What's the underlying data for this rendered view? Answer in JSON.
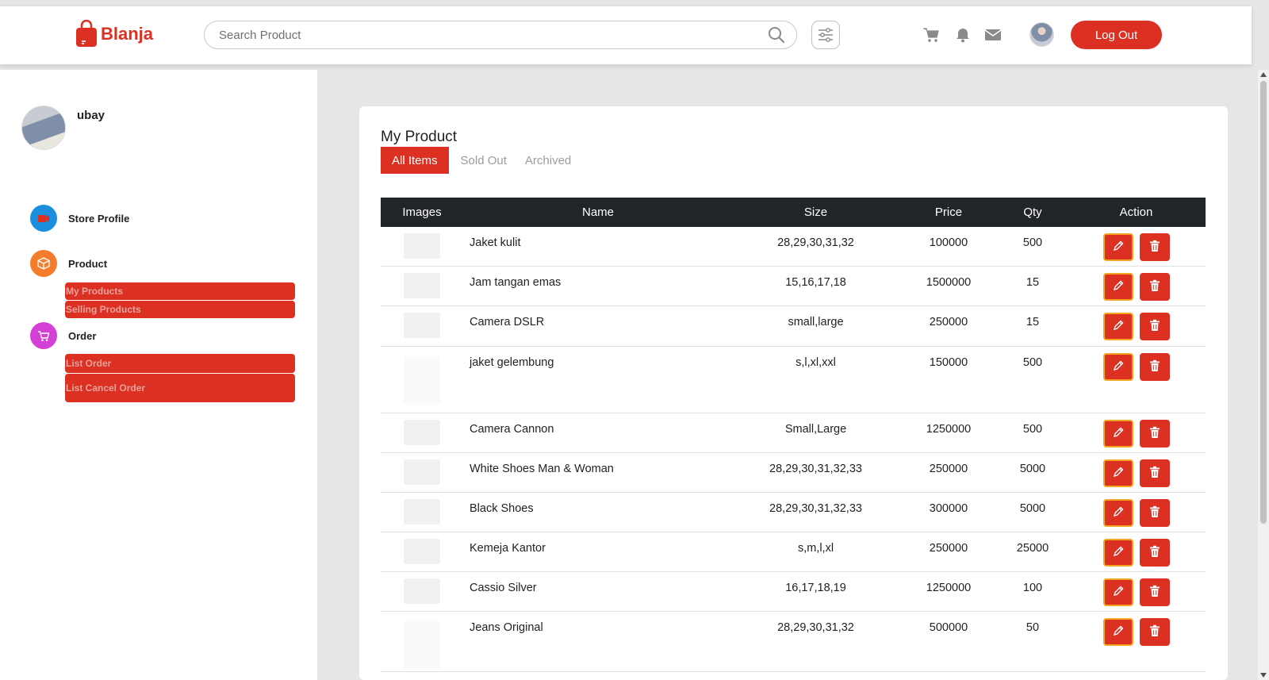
{
  "header": {
    "brand": "Blanja",
    "search_placeholder": "Search Product",
    "logout_label": "Log Out"
  },
  "sidebar": {
    "username": "ubay",
    "sections": [
      {
        "label": "Store Profile",
        "color": "#1a8fdd"
      },
      {
        "label": "Product",
        "color": "#f47c2b"
      },
      {
        "label": "Order",
        "color": "#d43fd6"
      }
    ],
    "product_links": [
      "My Products",
      "Selling Products"
    ],
    "order_links": [
      "List Order",
      "List Cancel Order"
    ]
  },
  "main": {
    "title": "My Product",
    "tabs": [
      "All Items",
      "Sold Out",
      "Archived"
    ],
    "columns": [
      "Images",
      "Name",
      "Size",
      "Price",
      "Qty",
      "Action"
    ],
    "rows": [
      {
        "name": "Jaket kulit",
        "size": "28,29,30,31,32",
        "price": "100000",
        "qty": "500"
      },
      {
        "name": "Jam tangan emas",
        "size": "15,16,17,18",
        "price": "1500000",
        "qty": "15"
      },
      {
        "name": "Camera DSLR",
        "size": "small,large",
        "price": "250000",
        "qty": "15"
      },
      {
        "name": "jaket gelembung",
        "size": "s,l,xl,xxl",
        "price": "150000",
        "qty": "500"
      },
      {
        "name": "Camera Cannon",
        "size": "Small,Large",
        "price": "1250000",
        "qty": "500"
      },
      {
        "name": "White Shoes Man & Woman",
        "size": "28,29,30,31,32,33",
        "price": "250000",
        "qty": "5000"
      },
      {
        "name": "Black Shoes",
        "size": "28,29,30,31,32,33",
        "price": "300000",
        "qty": "5000"
      },
      {
        "name": "Kemeja Kantor",
        "size": "s,m,l,xl",
        "price": "250000",
        "qty": "25000"
      },
      {
        "name": "Cassio Silver",
        "size": "16,17,18,19",
        "price": "1250000",
        "qty": "100"
      },
      {
        "name": "Jeans Original",
        "size": "28,29,30,31,32",
        "price": "500000",
        "qty": "50"
      }
    ]
  },
  "colors": {
    "accent": "#db3022",
    "table_header": "#212529"
  }
}
